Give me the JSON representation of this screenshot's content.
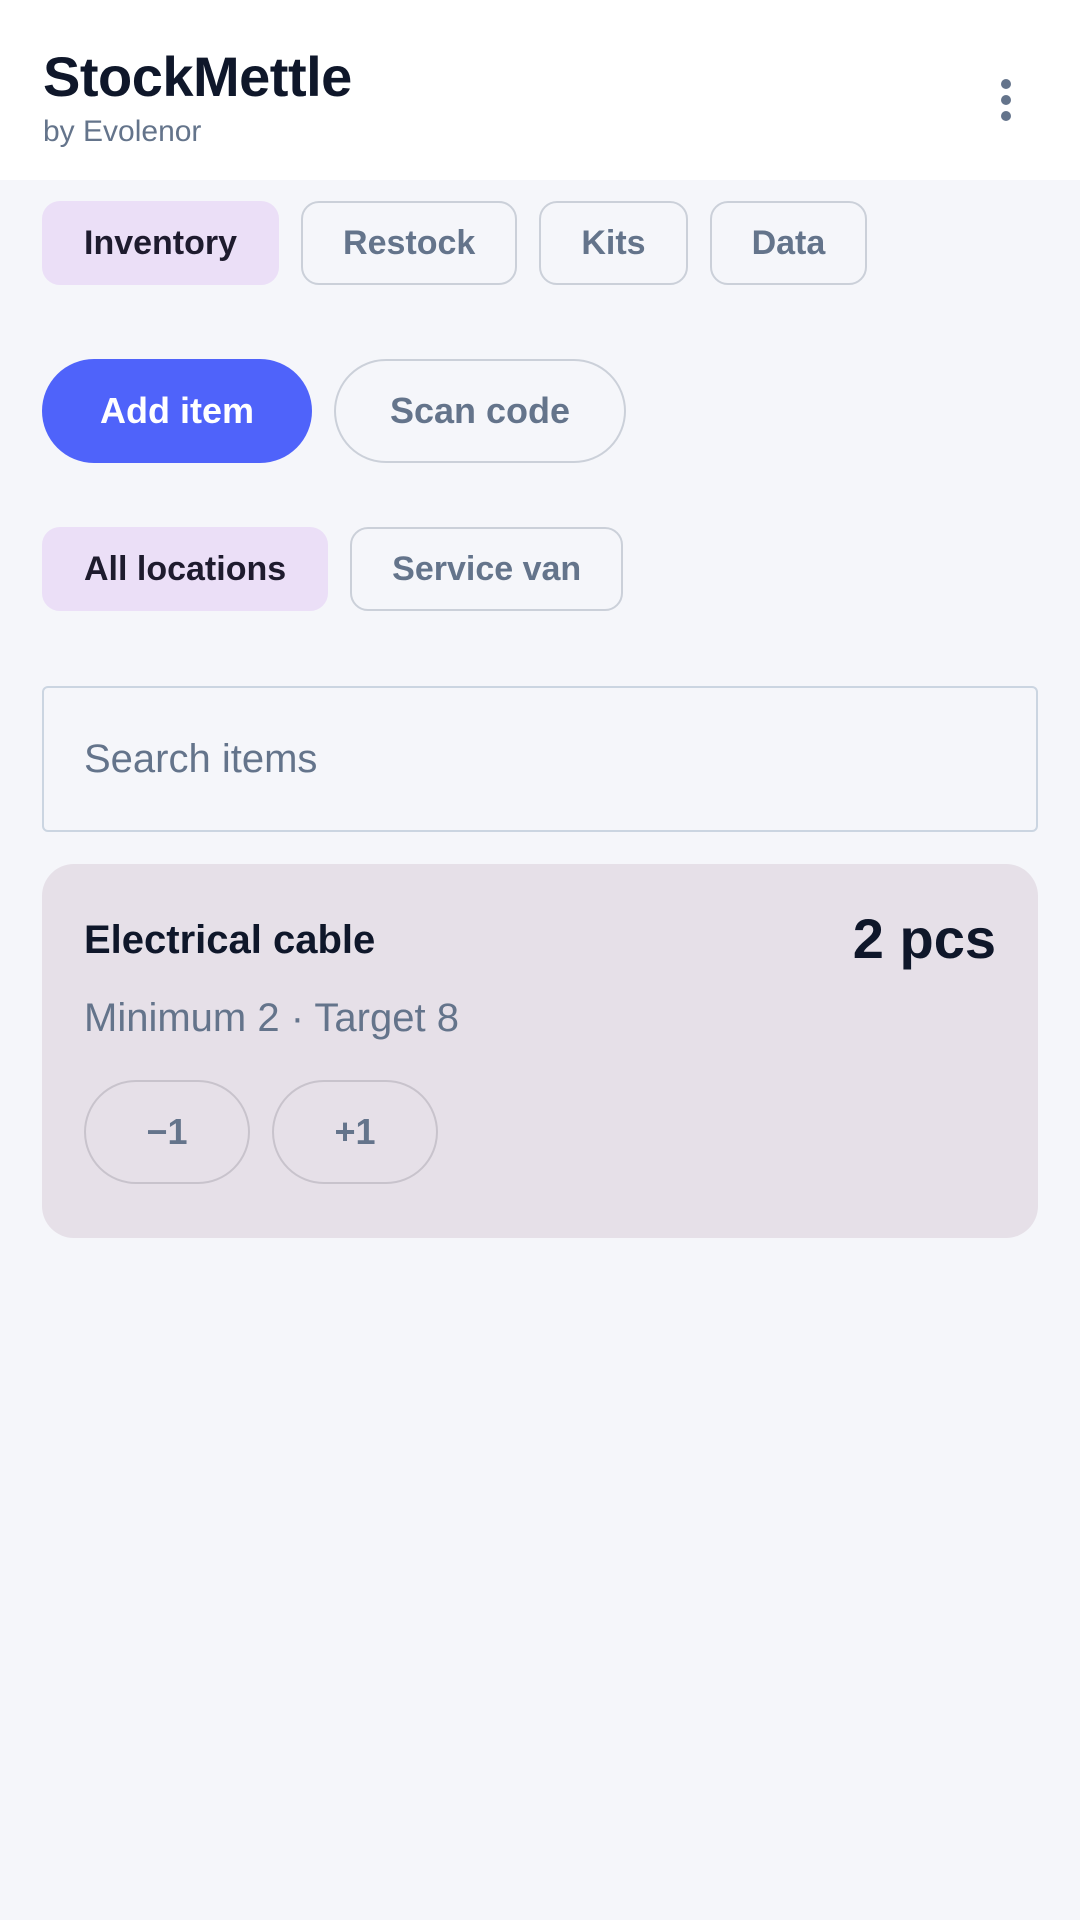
{
  "header": {
    "title": "StockMettle",
    "subtitle": "by Evolenor",
    "menu_icon": "more-vertical-icon"
  },
  "tabs": [
    {
      "label": "Inventory",
      "active": true
    },
    {
      "label": "Restock",
      "active": false
    },
    {
      "label": "Kits",
      "active": false
    },
    {
      "label": "Data",
      "active": false
    }
  ],
  "actions": {
    "add_label": "Add item",
    "scan_label": "Scan code"
  },
  "filters": [
    {
      "label": "All locations",
      "active": true
    },
    {
      "label": "Service van",
      "active": false
    }
  ],
  "search": {
    "placeholder": "Search items",
    "value": ""
  },
  "items": [
    {
      "name": "Electrical cable",
      "quantity": "2 pcs",
      "meta": "Minimum 2 · Target 8",
      "decrement_label": "−1",
      "increment_label": "+1"
    }
  ],
  "colors": {
    "accent": "#4f63fa",
    "active_chip": "#ebdff7",
    "card_bg": "#e6e0e8",
    "page_bg": "#f5f6fa"
  }
}
